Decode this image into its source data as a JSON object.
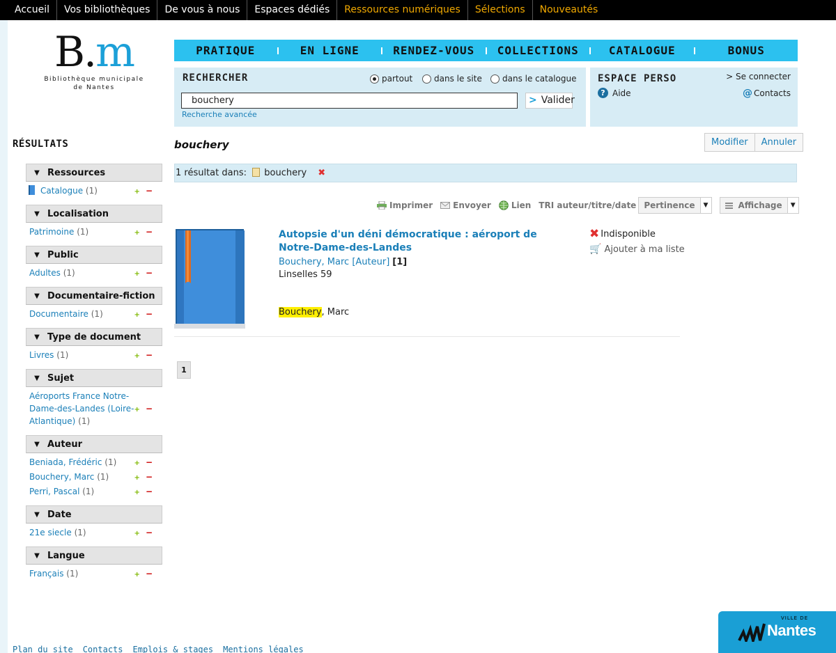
{
  "topnav": [
    {
      "label": "Accueil",
      "accent": false
    },
    {
      "label": "Vos bibliothèques",
      "accent": false
    },
    {
      "label": "De vous à nous",
      "accent": false
    },
    {
      "label": "Espaces dédiés",
      "accent": false
    },
    {
      "label": "Ressources numériques",
      "accent": true
    },
    {
      "label": "Sélections",
      "accent": true
    },
    {
      "label": "Nouveautés",
      "accent": true
    }
  ],
  "logo": {
    "mark_main": "B.",
    "mark_accent": "m",
    "line1": "Bibliothèque municipale",
    "line2": "de Nantes"
  },
  "mainnav": [
    "PRATIQUE",
    "EN LIGNE",
    "RENDEZ-VOUS",
    "COLLECTIONS",
    "CATALOGUE",
    "BONUS"
  ],
  "search": {
    "title": "RECHERCHER",
    "scopes": [
      {
        "label": "partout",
        "selected": true
      },
      {
        "label": "dans le site",
        "selected": false
      },
      {
        "label": "dans le catalogue",
        "selected": false
      }
    ],
    "query": "bouchery",
    "submit_arrow": ">",
    "submit_label": "Valider",
    "advanced_link": "Recherche avancée"
  },
  "perso": {
    "title": "ESPACE PERSO",
    "connect": "> Se connecter",
    "help": "Aide",
    "help_icon": "?",
    "contacts_at": "@",
    "contacts": "Contacts"
  },
  "results_title": "RÉSULTATS",
  "facets": [
    {
      "title": "Ressources",
      "items": [
        {
          "label": "Catalogue",
          "count": "(1)",
          "icon": "book-icon"
        }
      ]
    },
    {
      "title": "Localisation",
      "items": [
        {
          "label": "Patrimoine",
          "count": "(1)"
        }
      ]
    },
    {
      "title": "Public",
      "items": [
        {
          "label": "Adultes",
          "count": "(1)"
        }
      ]
    },
    {
      "title": "Documentaire-fiction",
      "items": [
        {
          "label": "Documentaire",
          "count": "(1)"
        }
      ]
    },
    {
      "title": "Type de document",
      "items": [
        {
          "label": "Livres",
          "count": "(1)"
        }
      ]
    },
    {
      "title": "Sujet",
      "items": [
        {
          "label": "Aéroports France Notre-Dame-des-Landes (Loire-Atlantique)",
          "count": "(1)"
        }
      ]
    },
    {
      "title": "Auteur",
      "items": [
        {
          "label": "Beniada, Frédéric",
          "count": "(1)"
        },
        {
          "label": "Bouchery, Marc",
          "count": "(1)"
        },
        {
          "label": "Perri, Pascal",
          "count": "(1)"
        }
      ]
    },
    {
      "title": "Date",
      "items": [
        {
          "label": "21e siecle",
          "count": "(1)"
        }
      ]
    },
    {
      "title": "Langue",
      "items": [
        {
          "label": "Français",
          "count": "(1)"
        }
      ]
    }
  ],
  "facet_symbols": {
    "plus": "+",
    "minus": "−",
    "chevron": "▼"
  },
  "query_title": "bouchery",
  "modify_label": "Modifier",
  "cancel_label": "Annuler",
  "criteria": {
    "prefix": "1 résultat dans:",
    "term": "bouchery",
    "remove": "✖"
  },
  "toolbar": {
    "print": "Imprimer",
    "send": "Envoyer",
    "link": "Lien",
    "sort_label": "TRI auteur/titre/date",
    "sort_value": "Pertinence",
    "display_value": "Affichage",
    "dropdown_arrow": "▼"
  },
  "result": {
    "title": "Autopsie d'un déni démocratique : aéroport de Notre-Dame-des-Landes",
    "author": "Bouchery, Marc [Auteur]",
    "author_num": "[1]",
    "place": "Linselles 59",
    "highlight": "Bouchery",
    "highlight_rest": ", Marc",
    "availability": "Indisponible",
    "availability_icon": "✖",
    "add_to_list": "Ajouter à ma liste",
    "cart_icon": "🛒"
  },
  "pagination": {
    "current": "1"
  },
  "footer": [
    "Plan du site",
    "Contacts",
    "Emplois & stages",
    "Mentions légales"
  ],
  "city_logo": {
    "small": "VILLE DE",
    "name": "Nantes"
  },
  "colors": {
    "nav_blue": "#2cc1ef",
    "panel_blue": "#d7ecf5",
    "link": "#1a7fb8",
    "accent_orange": "#f0a800"
  }
}
